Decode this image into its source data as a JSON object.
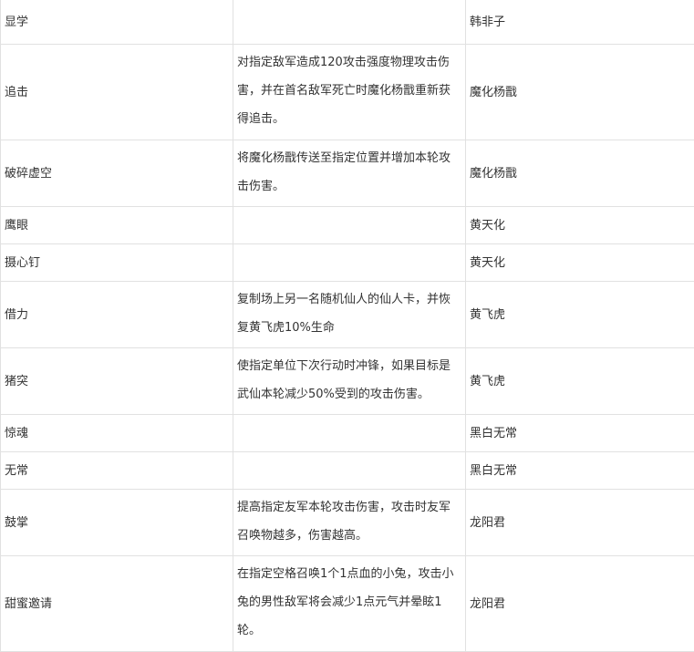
{
  "rows": [
    {
      "skill": "显学",
      "desc": "",
      "hero": "韩非子"
    },
    {
      "skill": "追击",
      "desc": "对指定敌军造成120攻击强度物理攻击伤害，并在首名敌军死亡时魔化杨戬重新获得追击。",
      "hero": "魔化杨戬"
    },
    {
      "skill": "破碎虚空",
      "desc": "将魔化杨戬传送至指定位置并增加本轮攻击伤害。",
      "hero": "魔化杨戬"
    },
    {
      "skill": "鹰眼",
      "desc": "",
      "hero": "黄天化"
    },
    {
      "skill": "摄心钉",
      "desc": "",
      "hero": "黄天化"
    },
    {
      "skill": "借力",
      "desc": "复制场上另一名随机仙人的仙人卡，并恢复黄飞虎10%生命",
      "hero": "黄飞虎"
    },
    {
      "skill": "猪突",
      "desc": "使指定单位下次行动时冲锋，如果目标是武仙本轮减少50%受到的攻击伤害。",
      "hero": "黄飞虎"
    },
    {
      "skill": "惊魂",
      "desc": "",
      "hero": "黑白无常"
    },
    {
      "skill": "无常",
      "desc": "",
      "hero": "黑白无常"
    },
    {
      "skill": "鼓掌",
      "desc": "提高指定友军本轮攻击伤害，攻击时友军召唤物越多，伤害越高。",
      "hero": "龙阳君"
    },
    {
      "skill": "甜蜜邀请",
      "desc": "在指定空格召唤1个1点血的小兔，攻击小兔的男性敌军将会减少1点元气并晕眩1轮。",
      "hero": "龙阳君"
    }
  ]
}
